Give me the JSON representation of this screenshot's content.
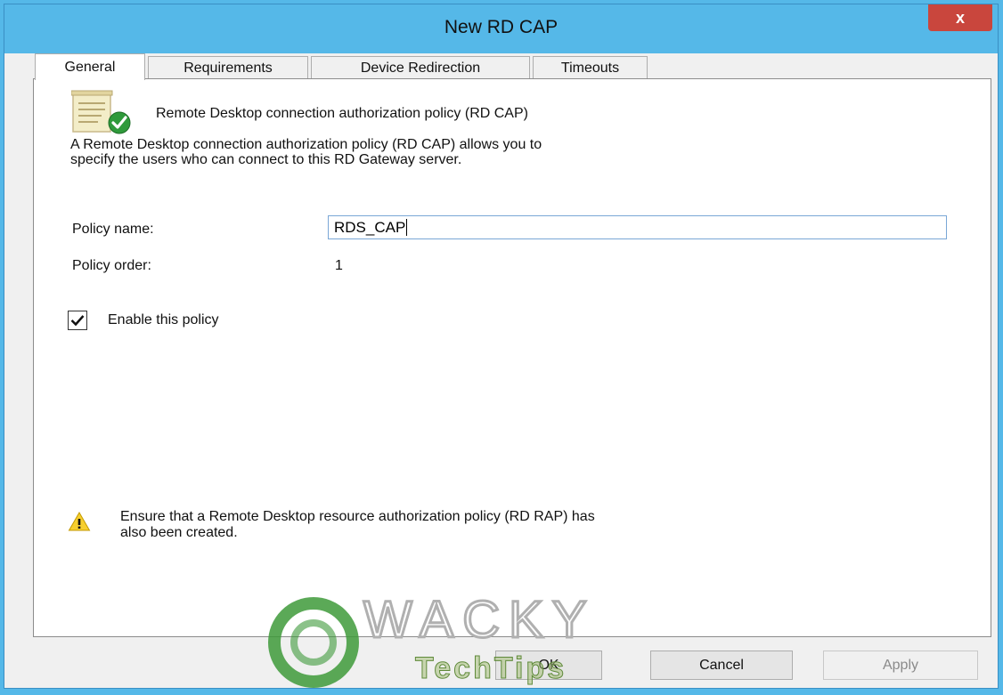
{
  "window": {
    "title": "New RD CAP",
    "close_label": "x"
  },
  "tabs": [
    {
      "label": "General",
      "active": true
    },
    {
      "label": "Requirements",
      "active": false
    },
    {
      "label": "Device Redirection",
      "active": false
    },
    {
      "label": "Timeouts",
      "active": false
    }
  ],
  "general": {
    "heading": "Remote Desktop connection authorization policy (RD CAP)",
    "description_line1": "A Remote Desktop connection authorization policy (RD CAP) allows you to",
    "description_line2": "specify the users who can connect to this RD Gateway server.",
    "policy_name_label": "Policy name:",
    "policy_name_value": "RDS_CAP",
    "policy_order_label": "Policy order:",
    "policy_order_value": "1",
    "enable_label": "Enable this policy",
    "enable_checked": true,
    "warning_line1": "Ensure that a Remote Desktop resource authorization policy (RD RAP) has",
    "warning_line2": "also been created."
  },
  "buttons": {
    "ok": "OK",
    "cancel": "Cancel",
    "apply": "Apply"
  },
  "watermark": {
    "line1": "WACKY",
    "line2": "TechTips"
  },
  "colors": {
    "titlebar": "#55b8e8",
    "close": "#c9463d",
    "watermark_green": "#3e9a3a",
    "watermark_gray": "#b0b0b0"
  }
}
